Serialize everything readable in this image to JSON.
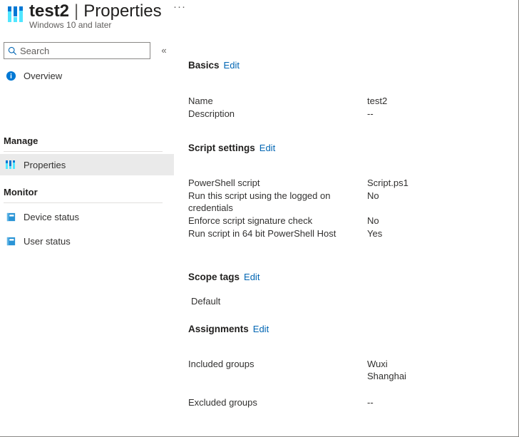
{
  "header": {
    "icon": "script-bars-icon",
    "title": "test2",
    "separator": "|",
    "page": "Properties",
    "subtitle": "Windows 10 and later",
    "more_menu": "···"
  },
  "sidebar": {
    "search": {
      "placeholder": "Search",
      "value": "",
      "icon": "search-icon"
    },
    "collapse": "«",
    "overview": {
      "label": "Overview",
      "icon": "info-circle-icon"
    },
    "groups": [
      {
        "label": "Manage",
        "items": [
          {
            "label": "Properties",
            "icon": "script-bars-icon",
            "selected": true
          }
        ]
      },
      {
        "label": "Monitor",
        "items": [
          {
            "label": "Device status",
            "icon": "report-icon",
            "selected": false
          },
          {
            "label": "User status",
            "icon": "report-icon",
            "selected": false
          }
        ]
      }
    ]
  },
  "main": {
    "edit_label": "Edit",
    "sections": {
      "basics": {
        "title": "Basics",
        "rows": [
          {
            "key": "Name",
            "value": "test2"
          },
          {
            "key": "Description",
            "value": "--"
          }
        ]
      },
      "script_settings": {
        "title": "Script settings",
        "rows": [
          {
            "key": "PowerShell script",
            "value": "Script.ps1"
          },
          {
            "key": "Run this script using the logged on credentials",
            "value": "No"
          },
          {
            "key": "Enforce script signature check",
            "value": "No"
          },
          {
            "key": "Run script in 64 bit PowerShell Host",
            "value": "Yes"
          }
        ]
      },
      "scope_tags": {
        "title": "Scope tags",
        "tags": [
          "Default"
        ]
      },
      "assignments": {
        "title": "Assignments",
        "rows": [
          {
            "key": "Included groups",
            "value": "Wuxi\nShanghai"
          },
          {
            "key": "Excluded groups",
            "value": "--"
          }
        ]
      }
    }
  },
  "colors": {
    "accent_link": "#0065b3",
    "icon_blue_dark": "#0078d4",
    "icon_cyan": "#50e6ff",
    "selected_bg": "#eaeaea",
    "divider": "#e1dfdd",
    "border": "#8a8886"
  }
}
